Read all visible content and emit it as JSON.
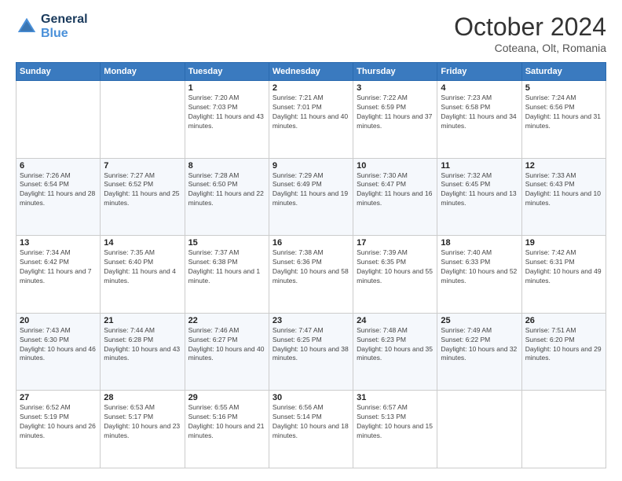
{
  "header": {
    "logo_line1": "General",
    "logo_line2": "Blue",
    "month": "October 2024",
    "location": "Coteana, Olt, Romania"
  },
  "days_of_week": [
    "Sunday",
    "Monday",
    "Tuesday",
    "Wednesday",
    "Thursday",
    "Friday",
    "Saturday"
  ],
  "weeks": [
    [
      {
        "day": "",
        "info": ""
      },
      {
        "day": "",
        "info": ""
      },
      {
        "day": "1",
        "info": "Sunrise: 7:20 AM\nSunset: 7:03 PM\nDaylight: 11 hours and 43 minutes."
      },
      {
        "day": "2",
        "info": "Sunrise: 7:21 AM\nSunset: 7:01 PM\nDaylight: 11 hours and 40 minutes."
      },
      {
        "day": "3",
        "info": "Sunrise: 7:22 AM\nSunset: 6:59 PM\nDaylight: 11 hours and 37 minutes."
      },
      {
        "day": "4",
        "info": "Sunrise: 7:23 AM\nSunset: 6:58 PM\nDaylight: 11 hours and 34 minutes."
      },
      {
        "day": "5",
        "info": "Sunrise: 7:24 AM\nSunset: 6:56 PM\nDaylight: 11 hours and 31 minutes."
      }
    ],
    [
      {
        "day": "6",
        "info": "Sunrise: 7:26 AM\nSunset: 6:54 PM\nDaylight: 11 hours and 28 minutes."
      },
      {
        "day": "7",
        "info": "Sunrise: 7:27 AM\nSunset: 6:52 PM\nDaylight: 11 hours and 25 minutes."
      },
      {
        "day": "8",
        "info": "Sunrise: 7:28 AM\nSunset: 6:50 PM\nDaylight: 11 hours and 22 minutes."
      },
      {
        "day": "9",
        "info": "Sunrise: 7:29 AM\nSunset: 6:49 PM\nDaylight: 11 hours and 19 minutes."
      },
      {
        "day": "10",
        "info": "Sunrise: 7:30 AM\nSunset: 6:47 PM\nDaylight: 11 hours and 16 minutes."
      },
      {
        "day": "11",
        "info": "Sunrise: 7:32 AM\nSunset: 6:45 PM\nDaylight: 11 hours and 13 minutes."
      },
      {
        "day": "12",
        "info": "Sunrise: 7:33 AM\nSunset: 6:43 PM\nDaylight: 11 hours and 10 minutes."
      }
    ],
    [
      {
        "day": "13",
        "info": "Sunrise: 7:34 AM\nSunset: 6:42 PM\nDaylight: 11 hours and 7 minutes."
      },
      {
        "day": "14",
        "info": "Sunrise: 7:35 AM\nSunset: 6:40 PM\nDaylight: 11 hours and 4 minutes."
      },
      {
        "day": "15",
        "info": "Sunrise: 7:37 AM\nSunset: 6:38 PM\nDaylight: 11 hours and 1 minute."
      },
      {
        "day": "16",
        "info": "Sunrise: 7:38 AM\nSunset: 6:36 PM\nDaylight: 10 hours and 58 minutes."
      },
      {
        "day": "17",
        "info": "Sunrise: 7:39 AM\nSunset: 6:35 PM\nDaylight: 10 hours and 55 minutes."
      },
      {
        "day": "18",
        "info": "Sunrise: 7:40 AM\nSunset: 6:33 PM\nDaylight: 10 hours and 52 minutes."
      },
      {
        "day": "19",
        "info": "Sunrise: 7:42 AM\nSunset: 6:31 PM\nDaylight: 10 hours and 49 minutes."
      }
    ],
    [
      {
        "day": "20",
        "info": "Sunrise: 7:43 AM\nSunset: 6:30 PM\nDaylight: 10 hours and 46 minutes."
      },
      {
        "day": "21",
        "info": "Sunrise: 7:44 AM\nSunset: 6:28 PM\nDaylight: 10 hours and 43 minutes."
      },
      {
        "day": "22",
        "info": "Sunrise: 7:46 AM\nSunset: 6:27 PM\nDaylight: 10 hours and 40 minutes."
      },
      {
        "day": "23",
        "info": "Sunrise: 7:47 AM\nSunset: 6:25 PM\nDaylight: 10 hours and 38 minutes."
      },
      {
        "day": "24",
        "info": "Sunrise: 7:48 AM\nSunset: 6:23 PM\nDaylight: 10 hours and 35 minutes."
      },
      {
        "day": "25",
        "info": "Sunrise: 7:49 AM\nSunset: 6:22 PM\nDaylight: 10 hours and 32 minutes."
      },
      {
        "day": "26",
        "info": "Sunrise: 7:51 AM\nSunset: 6:20 PM\nDaylight: 10 hours and 29 minutes."
      }
    ],
    [
      {
        "day": "27",
        "info": "Sunrise: 6:52 AM\nSunset: 5:19 PM\nDaylight: 10 hours and 26 minutes."
      },
      {
        "day": "28",
        "info": "Sunrise: 6:53 AM\nSunset: 5:17 PM\nDaylight: 10 hours and 23 minutes."
      },
      {
        "day": "29",
        "info": "Sunrise: 6:55 AM\nSunset: 5:16 PM\nDaylight: 10 hours and 21 minutes."
      },
      {
        "day": "30",
        "info": "Sunrise: 6:56 AM\nSunset: 5:14 PM\nDaylight: 10 hours and 18 minutes."
      },
      {
        "day": "31",
        "info": "Sunrise: 6:57 AM\nSunset: 5:13 PM\nDaylight: 10 hours and 15 minutes."
      },
      {
        "day": "",
        "info": ""
      },
      {
        "day": "",
        "info": ""
      }
    ]
  ]
}
